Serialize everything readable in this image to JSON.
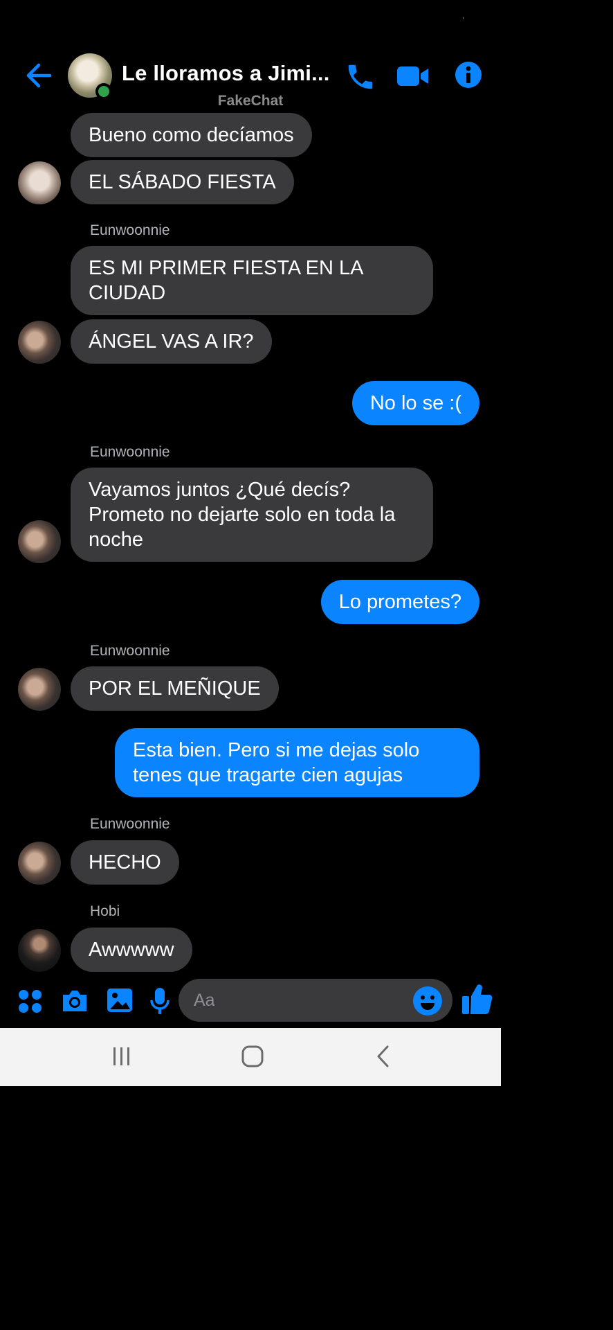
{
  "header": {
    "title": "Le lloramos a Jimi...",
    "watermark": "FakeChat"
  },
  "messages": [
    {
      "id": "m1",
      "text": "Bueno como decíamos"
    },
    {
      "id": "m2",
      "text": "EL SÁBADO FIESTA"
    },
    {
      "id": "s1",
      "sender": "Eunwoonnie"
    },
    {
      "id": "m3",
      "lines": [
        "ES MI PRIMER FIESTA EN LA",
        "CIUDAD"
      ]
    },
    {
      "id": "m4",
      "text": "ÁNGEL VAS A IR?"
    },
    {
      "id": "m5",
      "text": "No lo se :("
    },
    {
      "id": "s2",
      "sender": "Eunwoonnie"
    },
    {
      "id": "m6",
      "lines": [
        "Vayamos juntos ¿Qué decís?",
        "Prometo no dejarte solo en toda la",
        "noche"
      ]
    },
    {
      "id": "m7",
      "text": "Lo prometes?"
    },
    {
      "id": "s3",
      "sender": "Eunwoonnie"
    },
    {
      "id": "m8",
      "text": "POR EL MEÑIQUE"
    },
    {
      "id": "m9",
      "lines": [
        "Esta bien. Pero si me dejas solo",
        "tenes que tragarte cien agujas"
      ]
    },
    {
      "id": "s4",
      "sender": "Eunwoonnie"
    },
    {
      "id": "m10",
      "text": "HECHO"
    },
    {
      "id": "s5",
      "sender": "Hobi"
    },
    {
      "id": "m11",
      "text": "Awwwww"
    }
  ],
  "composer": {
    "placeholder": "Aa"
  },
  "colors": {
    "accent": "#0a84ff",
    "incoming_bubble": "#3a3a3c",
    "background": "#000000"
  },
  "icons": [
    "back-arrow-icon",
    "phone-icon",
    "video-camera-icon",
    "info-icon",
    "apps-grid-icon",
    "camera-icon",
    "gallery-icon",
    "microphone-icon",
    "emoji-icon",
    "thumbs-up-icon",
    "recents-icon",
    "home-icon",
    "nav-back-icon"
  ]
}
